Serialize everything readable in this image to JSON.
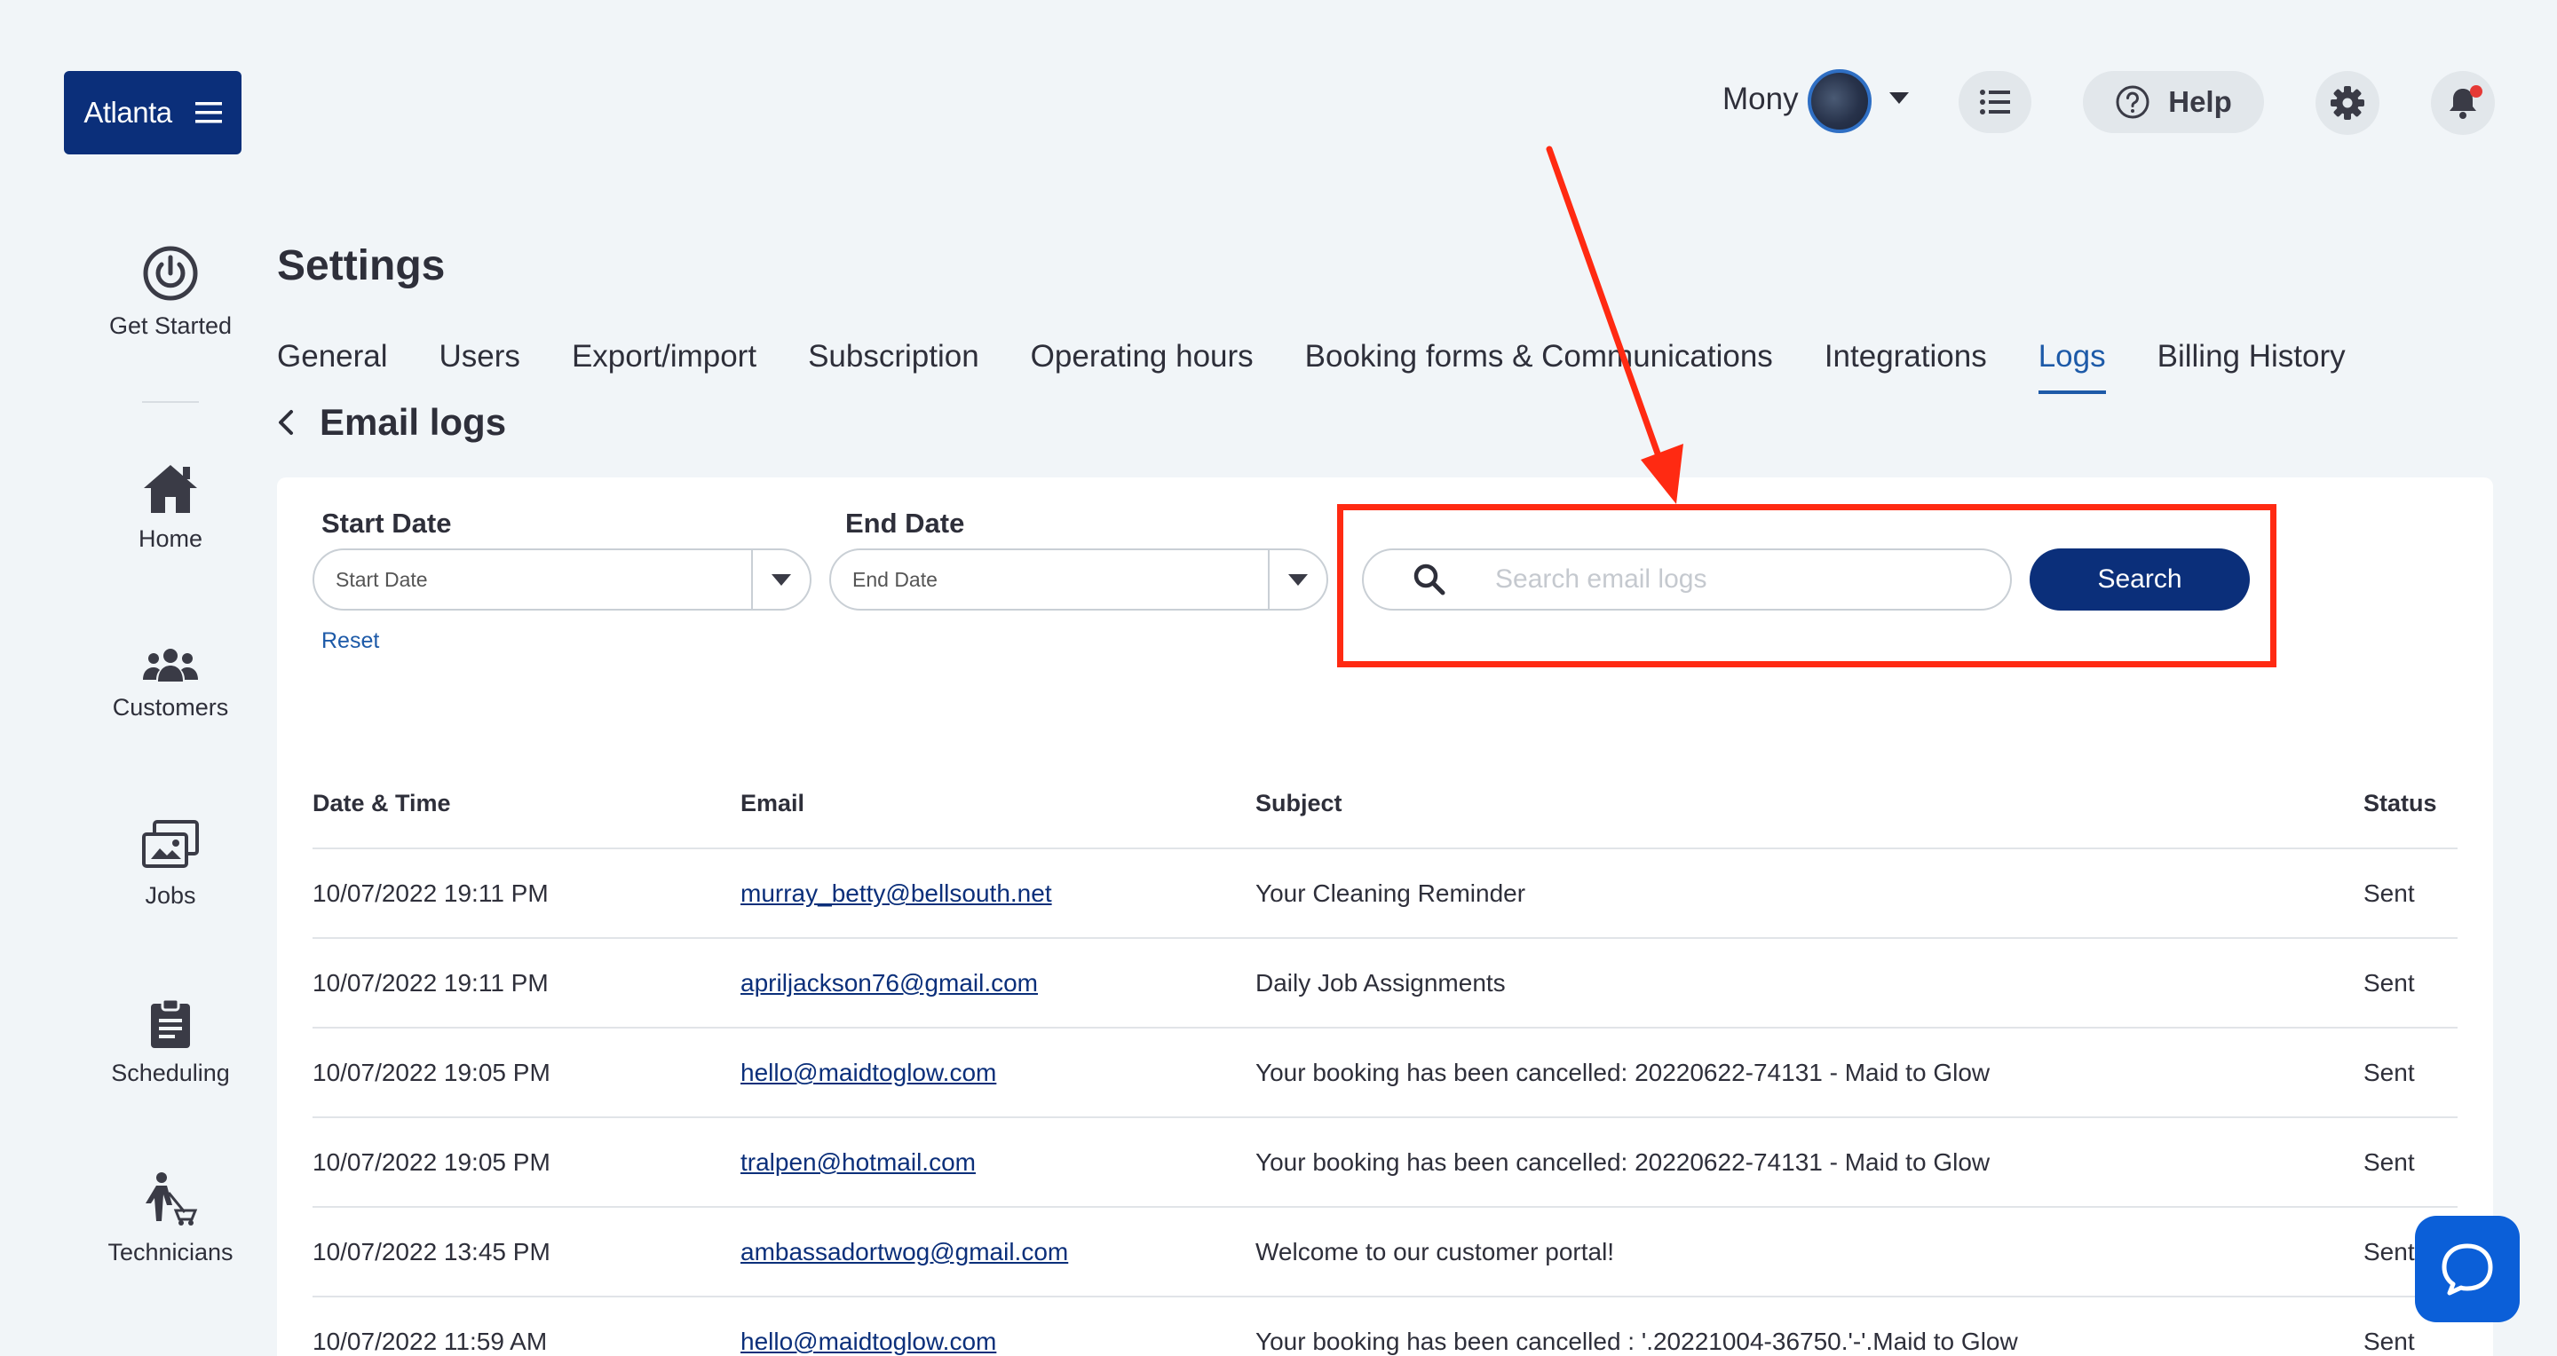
{
  "location": {
    "label": "Atlanta"
  },
  "header": {
    "user_name": "Mony",
    "help_label": "Help"
  },
  "sidebar": {
    "items": [
      {
        "label": "Get Started",
        "icon": "power-icon"
      },
      {
        "label": "Home",
        "icon": "home-icon"
      },
      {
        "label": "Customers",
        "icon": "users-icon"
      },
      {
        "label": "Jobs",
        "icon": "jobs-icon"
      },
      {
        "label": "Scheduling",
        "icon": "clipboard-icon"
      },
      {
        "label": "Technicians",
        "icon": "technician-icon"
      }
    ]
  },
  "page": {
    "title": "Settings",
    "tabs": [
      {
        "label": "General"
      },
      {
        "label": "Users"
      },
      {
        "label": "Export/import"
      },
      {
        "label": "Subscription"
      },
      {
        "label": "Operating hours"
      },
      {
        "label": "Booking forms & Communications"
      },
      {
        "label": "Integrations"
      },
      {
        "label": "Logs",
        "active": true
      },
      {
        "label": "Billing History"
      }
    ],
    "subtitle": "Email logs"
  },
  "filters": {
    "start_label": "Start Date",
    "start_value": "Start Date",
    "end_label": "End Date",
    "end_value": "End Date",
    "reset_label": "Reset",
    "search_placeholder": "Search email logs",
    "search_button": "Search"
  },
  "table": {
    "columns": [
      "Date & Time",
      "Email",
      "Subject",
      "Status"
    ],
    "rows": [
      {
        "datetime": "10/07/2022 19:11 PM",
        "email": "murray_betty@bellsouth.net",
        "subject": "Your Cleaning Reminder",
        "status": "Sent"
      },
      {
        "datetime": "10/07/2022 19:11 PM",
        "email": "apriljackson76@gmail.com",
        "subject": "Daily Job Assignments",
        "status": "Sent"
      },
      {
        "datetime": "10/07/2022 19:05 PM",
        "email": "hello@maidtoglow.com",
        "subject": "Your booking has been cancelled: 20220622-74131 - Maid to Glow",
        "status": "Sent"
      },
      {
        "datetime": "10/07/2022 19:05 PM",
        "email": "tralpen@hotmail.com",
        "subject": "Your booking has been cancelled: 20220622-74131 - Maid to Glow",
        "status": "Sent"
      },
      {
        "datetime": "10/07/2022 13:45 PM",
        "email": "ambassadortwog@gmail.com",
        "subject": "Welcome to our customer portal!",
        "status": "Sent"
      },
      {
        "datetime": "10/07/2022 11:59 AM",
        "email": "hello@maidtoglow.com",
        "subject": "Your booking has been cancelled : '.20221004-36750.'-'.Maid to Glow",
        "status": "Sent"
      }
    ]
  },
  "colors": {
    "brand": "#0b2f7a",
    "accent": "#1d5aa8",
    "annotation": "#ff2a12",
    "chat": "#0b5fd8"
  }
}
